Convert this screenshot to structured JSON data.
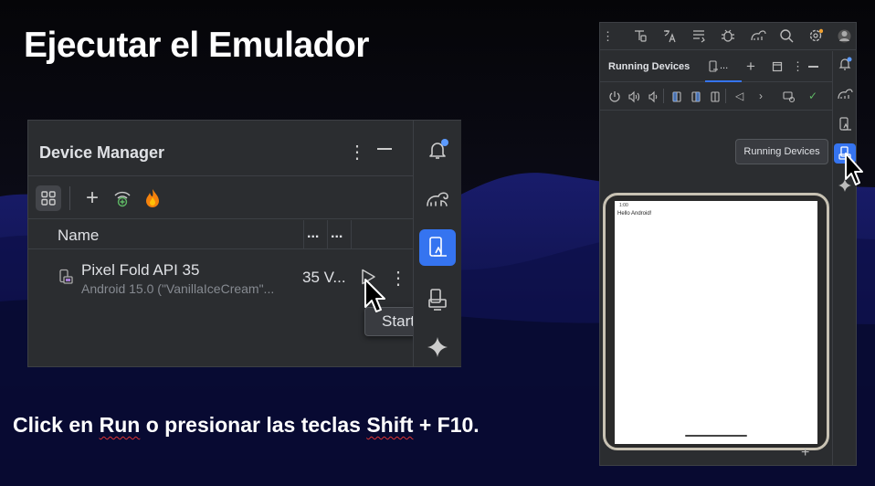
{
  "slide": {
    "title": "Ejecutar el Emulador",
    "caption_part1": "Click en ",
    "caption_run": "Run",
    "caption_part2": " o presionar las teclas ",
    "caption_shift": "Shift",
    "caption_part3": " + F10."
  },
  "device_manager": {
    "title": "Device Manager",
    "columns": {
      "name": "Name",
      "col2": "...",
      "col3": "..."
    },
    "device": {
      "name": "Pixel Fold API 35",
      "subtitle": "Android 15.0 (\"VanillaIceCream\"...",
      "api": "35 V..."
    },
    "start_tooltip": "Start",
    "icons": [
      "grid-icon",
      "add-icon",
      "wifi-pair-icon",
      "firebase-icon",
      "kebab-icon",
      "minimize-icon",
      "device-icon",
      "play-icon"
    ],
    "strip_icons": [
      "notifications-icon",
      "gradle-icon",
      "device-manager-icon",
      "running-devices-icon",
      "gemini-icon"
    ]
  },
  "running_devices": {
    "title": "Running Devices",
    "tab_label": "...",
    "tooltip": "Running Devices",
    "hello_text": "Hello Android!",
    "status_time": "1:00"
  },
  "colors": {
    "accent": "#3574f0",
    "panel": "#2b2d30",
    "notification_dot": "#5c9bff",
    "firebase": "#f5820d"
  }
}
